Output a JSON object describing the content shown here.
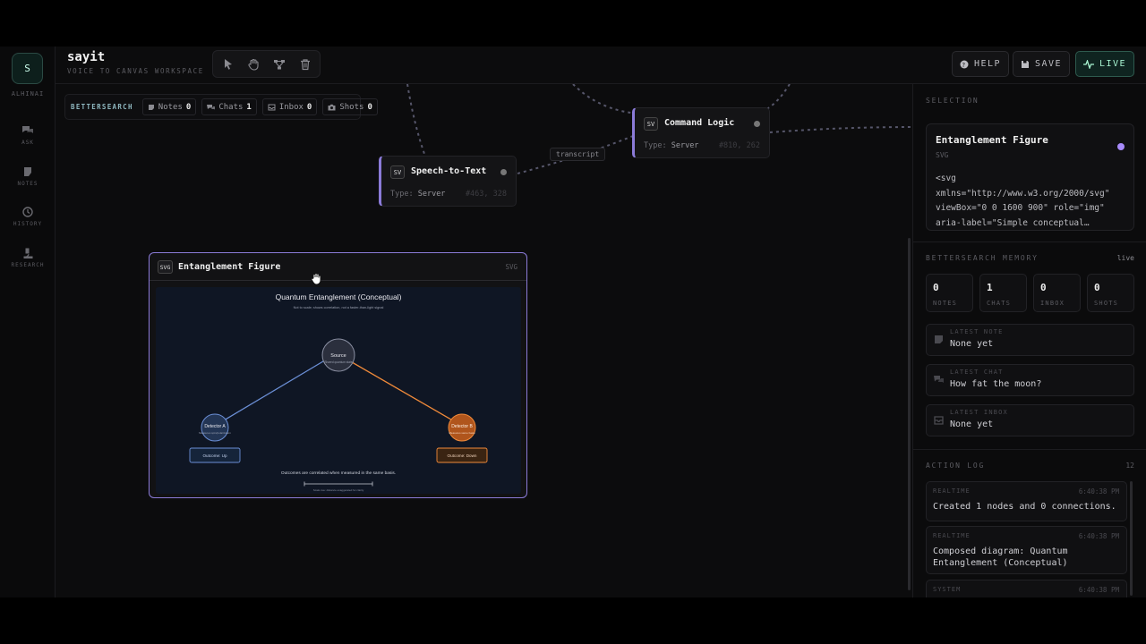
{
  "app": {
    "avatar_letter": "S",
    "org": "ALHINAI",
    "title": "sayit",
    "subtitle": "VOICE TO CANVAS WORKSPACE"
  },
  "rail": [
    {
      "label": "ASK",
      "icon": "chat-bubbles-icon"
    },
    {
      "label": "NOTES",
      "icon": "note-icon"
    },
    {
      "label": "HISTORY",
      "icon": "history-icon"
    },
    {
      "label": "RESEARCH",
      "icon": "microscope-icon"
    }
  ],
  "toolbar": {
    "tools": [
      "pointer-icon",
      "hand-icon",
      "connect-icon",
      "trash-icon"
    ],
    "help_label": "HELP",
    "save_label": "SAVE",
    "live_label": "LIVE",
    "accent": "#a7f3d0"
  },
  "bettersearch_bar": {
    "label": "BETTERSEARCH",
    "chips": [
      {
        "label": "Notes",
        "count": "0"
      },
      {
        "label": "Chats",
        "count": "1"
      },
      {
        "label": "Inbox",
        "count": "0"
      },
      {
        "label": "Shots",
        "count": "0"
      }
    ]
  },
  "nodes": {
    "stt": {
      "badge": "SV",
      "title": "Speech-to-Text",
      "type_key": "Type:",
      "type_val": "Server",
      "coords": "#463, 328"
    },
    "cmd": {
      "badge": "SV",
      "title": "Command Logic",
      "type_key": "Type:",
      "type_val": "Server",
      "coords": "#810, 262"
    },
    "edge_label": "transcript",
    "accent": "#8b7bd8"
  },
  "figure_node": {
    "badge": "SVG",
    "title": "Entanglement Figure",
    "tag": "SVG",
    "diagram": {
      "title": "Quantum Entanglement (Conceptual)",
      "subtitle": "Not to scale; shows correlation, not a faster-than-light signal",
      "source_label": "Source",
      "source_sub": "Shared quantum state",
      "detector_a": "Detector A",
      "detector_a_sub": "Measures spin/polarization",
      "detector_b": "Detector B",
      "detector_b_sub": "Measures same basis",
      "outcome_a": "Outcome: Up",
      "outcome_b": "Outcome: Down",
      "caption": "Outcomes are correlated when measured in the same basis.",
      "scale_note": "Scale cue: distance exaggerated for clarity",
      "color_a": "#6b8fd6",
      "color_b": "#f08a3a"
    }
  },
  "sidebar": {
    "selection_header": "SELECTION",
    "selection": {
      "title": "Entanglement Figure",
      "type": "SVG",
      "code": "<svg\nxmlns=\"http://www.w3.org/2000/svg\"\nviewBox=\"0 0 1600 900\" role=\"img\"\naria-label=\"Simple conceptual…",
      "dot_color": "#a78bfa"
    },
    "memory_header": "BETTERSEARCH MEMORY",
    "memory_status": "live",
    "stats": [
      {
        "value": "0",
        "label": "NOTES"
      },
      {
        "value": "1",
        "label": "CHATS"
      },
      {
        "value": "0",
        "label": "INBOX"
      },
      {
        "value": "0",
        "label": "SHOTS"
      }
    ],
    "latest": [
      {
        "key": "LATEST NOTE",
        "value": "None yet",
        "icon": "note-icon"
      },
      {
        "key": "LATEST CHAT",
        "value": "How fat the moon?",
        "icon": "chat-bubbles-icon"
      },
      {
        "key": "LATEST INBOX",
        "value": "None yet",
        "icon": "inbox-icon"
      }
    ],
    "log_header": "ACTION LOG",
    "log_count": "12",
    "log": [
      {
        "kind": "REALTIME",
        "time": "6:40:38 PM",
        "text": "Created 1 nodes and 0 connections."
      },
      {
        "kind": "REALTIME",
        "time": "6:40:38 PM",
        "text": "Composed diagram: Quantum Entanglement (Conceptual)"
      },
      {
        "kind": "SYSTEM",
        "time": "6:40:38 PM",
        "text": ""
      }
    ]
  }
}
